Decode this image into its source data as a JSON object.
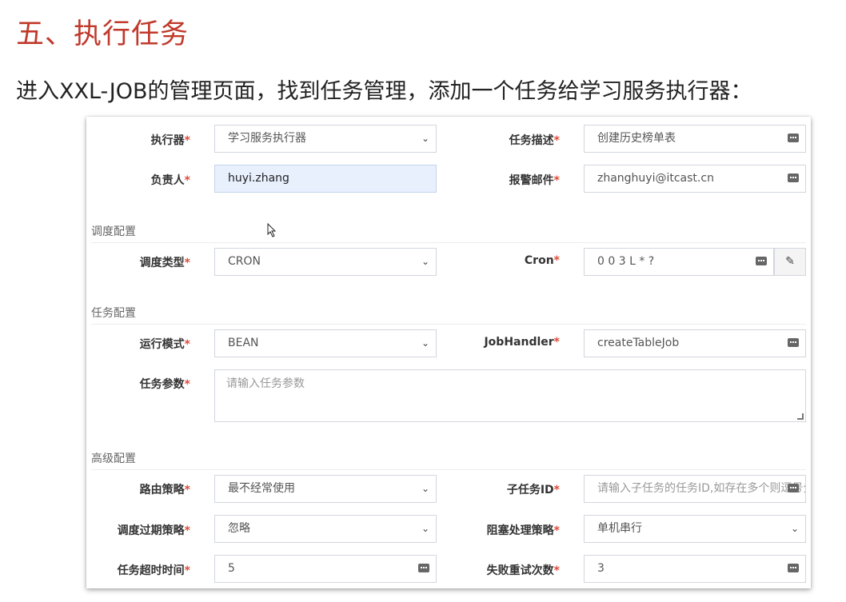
{
  "heading": "五、执行任务",
  "intro": "进入XXL-JOB的管理页面，找到任务管理，添加一个任务给学习服务执行器：",
  "required_mark": "*",
  "icons": {
    "select": "chevron-down-icon",
    "keyboard": "keyboard-icon",
    "edit": "edit-icon"
  },
  "form": {
    "executor": {
      "label": "执行器",
      "value": "学习服务执行器"
    },
    "job_desc": {
      "label": "任务描述",
      "value": "创建历史榜单表"
    },
    "author": {
      "label": "负责人",
      "value": "huyi.zhang"
    },
    "alarm_email": {
      "label": "报警邮件",
      "value": "zhanghuyi@itcast.cn"
    },
    "section_schedule": "调度配置",
    "schedule_type": {
      "label": "调度类型",
      "value": "CRON"
    },
    "cron": {
      "label": "Cron",
      "value": "0 0 3 L * ?",
      "edit_glyph": "✎"
    },
    "section_job": "任务配置",
    "glue_type": {
      "label": "运行模式",
      "value": "BEAN"
    },
    "job_handler": {
      "label": "JobHandler",
      "value": "createTableJob"
    },
    "job_param": {
      "label": "任务参数",
      "placeholder": "请输入任务参数"
    },
    "section_advanced": "高级配置",
    "route_strategy": {
      "label": "路由策略",
      "value": "最不经常使用"
    },
    "child_job": {
      "label": "子任务ID",
      "placeholder": "请输入子任务的任务ID,如存在多个则逗号分隔"
    },
    "misfire_strategy": {
      "label": "调度过期策略",
      "value": "忽略"
    },
    "block_strategy": {
      "label": "阻塞处理策略",
      "value": "单机串行"
    },
    "timeout": {
      "label": "任务超时时间",
      "value": "5"
    },
    "fail_retry": {
      "label": "失败重试次数",
      "value": "3"
    }
  }
}
